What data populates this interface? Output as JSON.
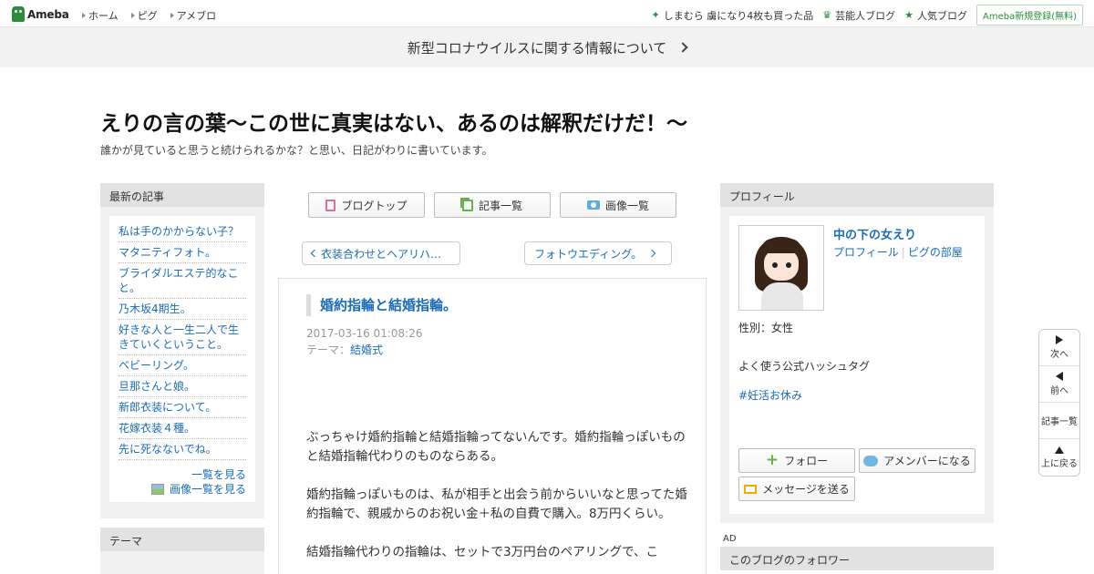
{
  "global_nav": {
    "logo": "Ameba",
    "links": [
      "ホーム",
      "ピグ",
      "アメブロ"
    ],
    "picks": [
      "しまむら 虜になり4枚も買った品",
      "芸能人ブログ",
      "人気ブログ"
    ],
    "register": "Ameba新規登録(無料)"
  },
  "banner": {
    "text": "新型コロナウイルスに関する情報について"
  },
  "blog": {
    "title": "えりの言の葉～この世に真実はない、あるのは解釈だけだ！～",
    "description": "誰かが見ていると思うと続けられるかな？と思い、日記がわりに書いています。"
  },
  "recent": {
    "heading": "最新の記事",
    "items": [
      "私は手のかからない子？",
      "マタニティフォト。",
      "ブライダルエステ的なこと。",
      "乃木坂4期生。",
      "好きな人と一生二人で生きていくということ。",
      "ベビーリング。",
      "旦那さんと娘。",
      "新郎衣装について。",
      "花嫁衣装４種。",
      "先に死なないでね。"
    ],
    "see_all": "一覧を見る",
    "see_images": "画像一覧を見る"
  },
  "theme_box": {
    "heading": "テーマ"
  },
  "center_nav": {
    "top": "ブログトップ",
    "list": "記事一覧",
    "images": "画像一覧"
  },
  "pager": {
    "prev": "衣装合わせとヘアリハ…",
    "next": "フォトウエディング。"
  },
  "article": {
    "title": "婚約指輪と結婚指輪。",
    "date": "2017-03-16 01:08:26",
    "theme_label": "テーマ：",
    "theme": "結婚式",
    "paragraphs": [
      "ぶっちゃけ婚約指輪と結婚指輪ってないんです。婚約指輪っぽいものと結婚指輪代わりのものならある。",
      "婚約指輪っぽいものは、私が相手と出会う前からいいなと思ってた婚約指輪で、親戚からのお祝い金＋私の自費で購入。8万円くらい。",
      "結婚指輪代わりの指輪は、セットで3万円台のペアリングで、こ"
    ]
  },
  "profile": {
    "heading": "プロフィール",
    "name": "中の下の女えり",
    "link_profile": "プロフィール",
    "link_room": "ピグの部屋",
    "gender": "性別：女性",
    "tag_title": "よく使う公式ハッシュタグ",
    "tag": "#妊活お休み",
    "follow": "フォロー",
    "member": "アメンバーになる",
    "message": "メッセージを送る"
  },
  "ad_label": "AD",
  "followers": {
    "heading": "このブログのフォロワー"
  },
  "float_nav": {
    "next": "次へ",
    "prev": "前へ",
    "list": "記事一覧",
    "top": "上に戻る"
  },
  "colors": {
    "link": "#1a6bb8",
    "brand": "#2d8c3c"
  }
}
